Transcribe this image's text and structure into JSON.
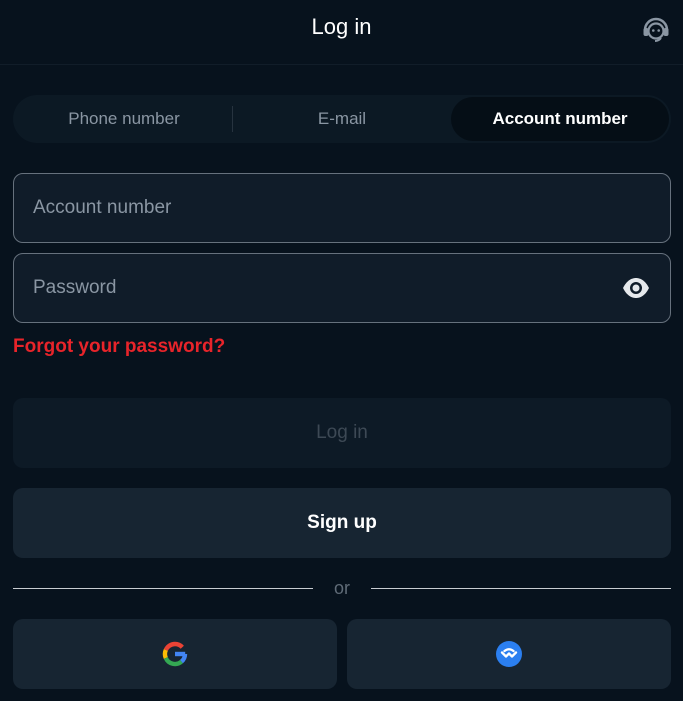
{
  "header": {
    "title": "Log in",
    "support_icon": "headset-icon"
  },
  "tabs": [
    {
      "label": "Phone number",
      "active": false
    },
    {
      "label": "E-mail",
      "active": false
    },
    {
      "label": "Account number",
      "active": true
    }
  ],
  "form": {
    "account_placeholder": "Account number",
    "account_value": "",
    "password_placeholder": "Password",
    "password_value": "",
    "password_toggle_icon": "eye-icon",
    "forgot_label": "Forgot your password?"
  },
  "actions": {
    "login_label": "Log in",
    "signup_label": "Sign up"
  },
  "divider": {
    "label": "or"
  },
  "social": [
    {
      "icon": "google-icon"
    },
    {
      "icon": "wallet-icon"
    }
  ],
  "colors": {
    "background": "#07121d",
    "forgot_link": "#e8242a",
    "accent_blue": "#2b7ff0"
  }
}
